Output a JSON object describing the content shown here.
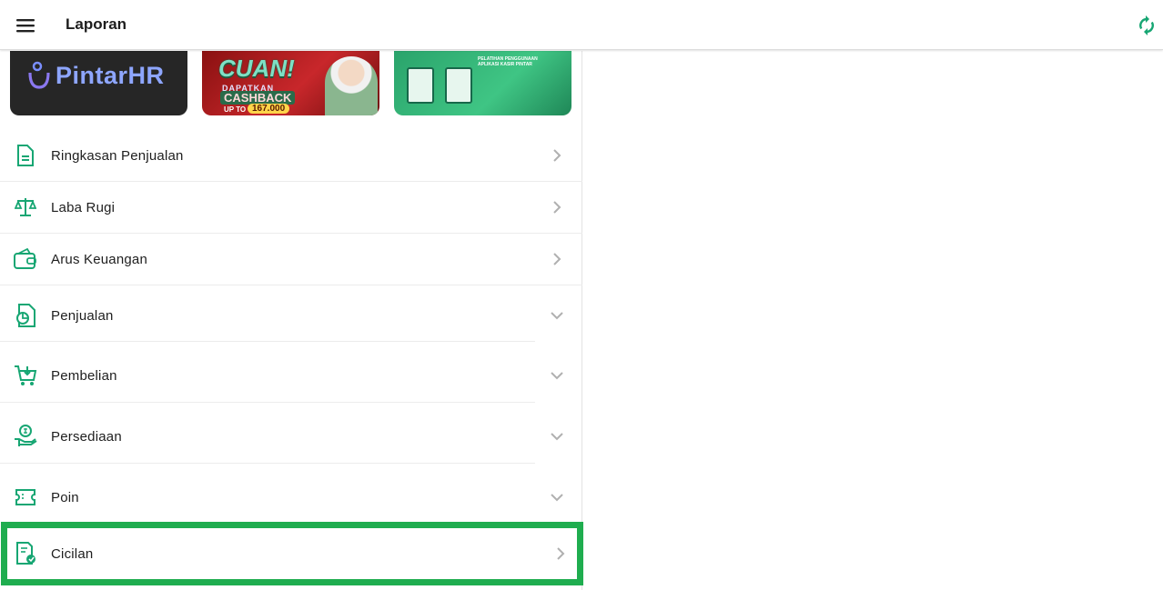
{
  "app": {
    "title": "Laporan"
  },
  "toolbar": {
    "menu_icon": "menu-icon",
    "refresh_icon": "refresh-icon"
  },
  "banners": [
    {
      "name": "pintar-hr-banner",
      "text": "PintarHR"
    },
    {
      "name": "cuan-cashback-banner",
      "headline": "CUAN!",
      "sub": "DAPATKAN",
      "cashback": "CASHBACK",
      "up_to": "UP TO",
      "amount": "167.000"
    },
    {
      "name": "pelatihan-banner",
      "text": "PELATIHAN PENGGUNAAN APLIKASI KASIR PINTAR"
    }
  ],
  "menu": {
    "items": [
      {
        "label": "Ringkasan Penjualan",
        "icon": "document-icon",
        "indicator": "chevron-right"
      },
      {
        "label": "Laba Rugi",
        "icon": "scale-icon",
        "indicator": "chevron-right"
      },
      {
        "label": "Arus Keuangan",
        "icon": "wallet-icon",
        "indicator": "chevron-right"
      },
      {
        "label": "Penjualan",
        "icon": "sales-report-icon",
        "indicator": "chevron-down"
      },
      {
        "label": "Pembelian",
        "icon": "cart-download-icon",
        "indicator": "chevron-down"
      },
      {
        "label": "Persediaan",
        "icon": "hand-coin-icon",
        "indicator": "chevron-down"
      },
      {
        "label": "Poin",
        "icon": "ticket-icon",
        "indicator": "chevron-down"
      },
      {
        "label": "Cicilan",
        "icon": "installment-icon",
        "indicator": "chevron-right"
      }
    ]
  },
  "colors": {
    "accent": "#17a673",
    "highlight": "#1fad4f",
    "chevron": "#b0b0b0"
  }
}
